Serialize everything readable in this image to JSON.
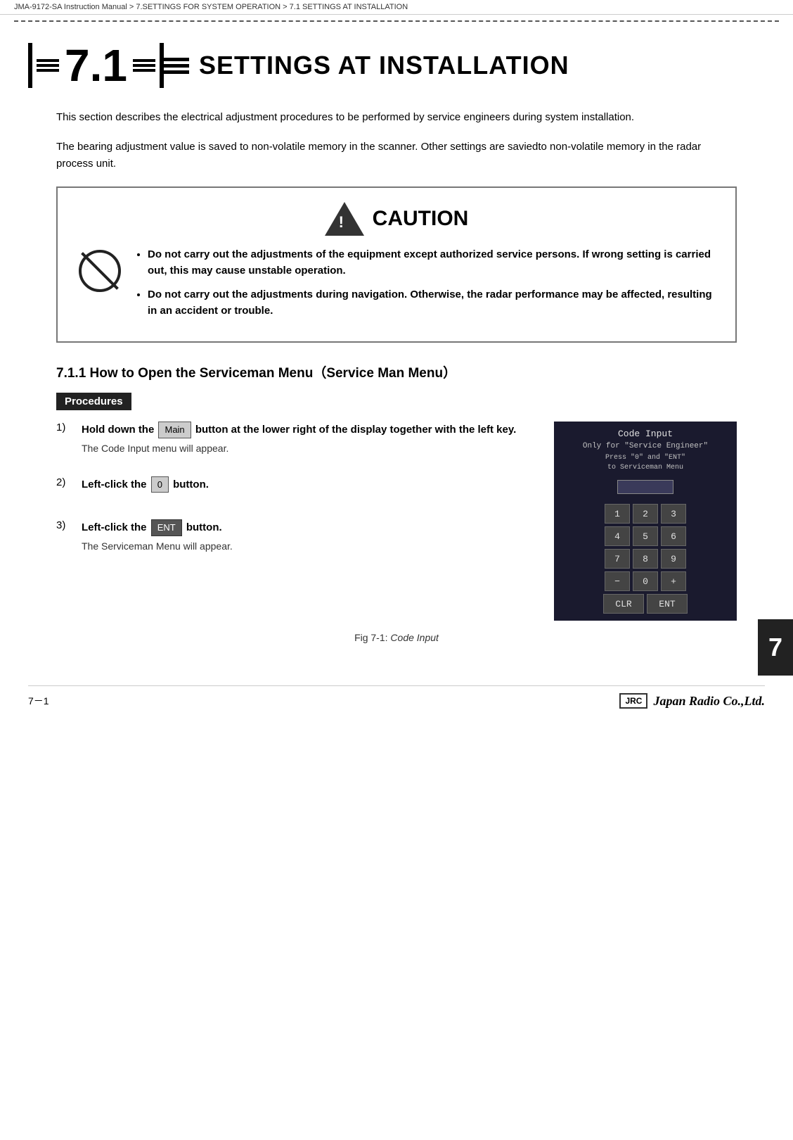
{
  "breadcrumb": {
    "text": "JMA-9172-SA Instruction Manual  >  7.SETTINGS FOR SYSTEM OPERATION  >  7.1  SETTINGS AT INSTALLATION"
  },
  "chapter": {
    "number": "7.1",
    "title": "SETTINGS AT INSTALLATION"
  },
  "intro": {
    "para1": "This section describes the electrical adjustment procedures to be performed by service engineers during system installation.",
    "para2": "The bearing adjustment value is saved to non-volatile memory in the scanner. Other settings are saviedto non-volatile memory in the radar process unit."
  },
  "caution": {
    "title": "CAUTION",
    "bullet1": "Do not carry out the adjustments of the equipment except authorized service persons. If wrong setting is carried out, this may cause unstable operation.",
    "bullet2": "Do not carry out the adjustments during navigation. Otherwise, the radar performance may be affected, resulting in an accident or trouble."
  },
  "section711": {
    "heading": "7.1.1    How to Open the Serviceman Menu（Service Man Menu）"
  },
  "procedures": {
    "label": "Procedures"
  },
  "steps": [
    {
      "num": "1)",
      "main_prefix": "Hold down the",
      "button1": "Main",
      "main_suffix": "button at the lower right of the display together with the left key.",
      "note": "The Code Input menu will appear."
    },
    {
      "num": "2)",
      "main_prefix": "Left-click the",
      "button1": "0",
      "main_suffix": "button.",
      "note": ""
    },
    {
      "num": "3)",
      "main_prefix": "Left-click the",
      "button1": "ENT",
      "main_suffix": "button.",
      "note": "The Serviceman Menu will appear."
    }
  ],
  "code_input_panel": {
    "title": "Code Input",
    "subtitle": "Only for \"Service Engineer\"",
    "instruction_line1": "Press \"0\" and \"ENT\"",
    "instruction_line2": "to Serviceman Menu",
    "keys": [
      [
        "1",
        "2",
        "3"
      ],
      [
        "4",
        "5",
        "6"
      ],
      [
        "7",
        "8",
        "9"
      ],
      [
        "-",
        "0",
        "+"
      ],
      [
        "CLR",
        "ENT"
      ]
    ]
  },
  "chapter_tab": {
    "number": "7"
  },
  "figure": {
    "caption": "Fig 7-1:",
    "caption_italic": "Code Input"
  },
  "footer": {
    "page": "7－1",
    "jrc_label": "JRC",
    "company": "Japan Radio Co.,Ltd."
  }
}
